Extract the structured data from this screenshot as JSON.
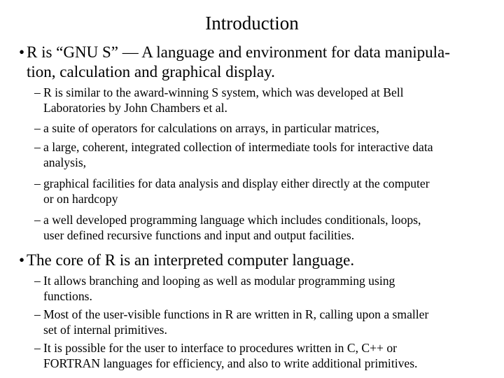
{
  "slide": {
    "title": "Introduction",
    "bullets": [
      {
        "marker": "•",
        "text": "R is “GNU S” — A language and environment for data manipula-tion, calculation and graphical display.",
        "line1": "R is “GNU S” — A language and environment for data manipula-",
        "line2": "tion, calculation and graphical display.",
        "subitems": [
          {
            "marker": "–",
            "line1": "R is similar to the award-winning S system, which was developed at Bell",
            "line2": "Laboratories by John Chambers et al."
          },
          {
            "marker": "–",
            "line1": "a suite of operators for calculations on arrays, in particular matrices,"
          },
          {
            "marker": "–",
            "line1": "a large, coherent, integrated collection of intermediate tools for interactive data",
            "line2": "analysis,"
          },
          {
            "marker": "–",
            "line1": "graphical facilities for data analysis and display either directly at the computer",
            "line2": "or on hardcopy"
          },
          {
            "marker": "–",
            "line1": "a well developed programming language which includes conditionals, loops,",
            "line2": "user defined recursive functions and input and output facilities."
          }
        ]
      },
      {
        "marker": "•",
        "line1": "The core of R is an interpreted computer language.",
        "subitems": [
          {
            "marker": "–",
            "line1": "It allows branching and looping as well as modular programming using",
            "line2": "functions."
          },
          {
            "marker": "–",
            "line1": "Most of the user-visible functions in R are written in R, calling upon a smaller",
            "line2": "set of internal primitives."
          },
          {
            "marker": "–",
            "line1": "It is possible for the user to interface to procedures written in C, C++ or",
            "line2": "FORTRAN languages for efficiency, and also to write additional primitives."
          }
        ]
      }
    ]
  }
}
